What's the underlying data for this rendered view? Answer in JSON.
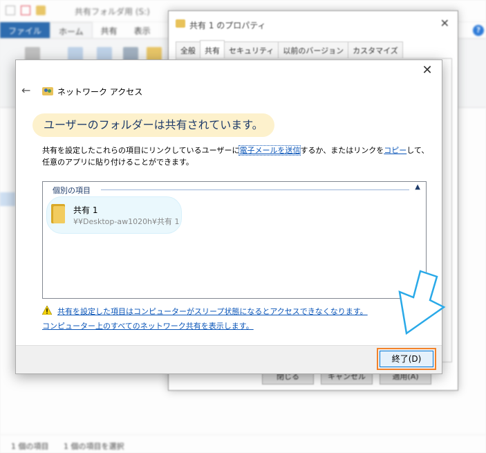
{
  "explorer": {
    "title": "共有フォルダ用 (S:)",
    "tabs": [
      "ファイル",
      "ホーム",
      "共有",
      "表示"
    ],
    "status_items": "1 個の項目",
    "status_selected": "1 個の項目を選択"
  },
  "properties": {
    "title": "共有 1 のプロパティ",
    "tabs": [
      "全般",
      "共有",
      "セキュリティ",
      "以前のバージョン",
      "カスタマイズ"
    ],
    "buttons": [
      "閉じる",
      "キャンセル",
      "適用(A)"
    ]
  },
  "dialog": {
    "title": "ネットワーク アクセス",
    "banner": "ユーザーのフォルダーは共有されています。",
    "desc_part1": "共有を設定したこれらの項目にリンクしているユーザーに",
    "desc_link_email": "電子メールを送信",
    "desc_part2": "するか、またはリンクを",
    "desc_link_copy": "コピー",
    "desc_part3": "して、任意のアプリに貼り付けることができます。",
    "group_header": "個別の項目",
    "item": {
      "name": "共有 1",
      "path": "¥¥Desktop-aw1020h¥共有 1"
    },
    "warning_link": "共有を設定した項目はコンピューターがスリープ状態になるとアクセスできなくなります。",
    "network_link": "コンピューター上のすべてのネットワーク共有を表示します。",
    "finish_button": "終了(D)"
  },
  "colors": {
    "accent": "#0a55b8",
    "banner_bg": "#fdf1cc",
    "highlight": "#f2822a",
    "arrow": "#29a9e8"
  }
}
